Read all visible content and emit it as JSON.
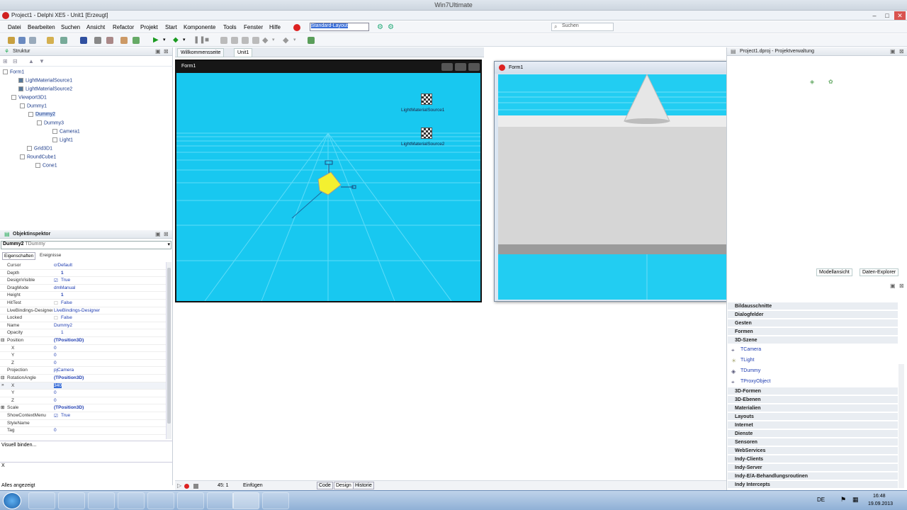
{
  "os_title": "Win7Ultimate",
  "ide_title": "Project1 - Delphi XE5 - Unit1 [Erzeugt]",
  "menu": [
    "Datei",
    "Bearbeiten",
    "Suchen",
    "Ansicht",
    "Refactor",
    "Projekt",
    "Start",
    "Komponente",
    "Tools",
    "Fenster",
    "Hilfe"
  ],
  "layout_select": "Standard-Layout",
  "search_placeholder": "Suchen",
  "structure": {
    "title": "Struktur",
    "nodes": [
      "Form1",
      "LightMaterialSource1",
      "LightMaterialSource2",
      "Viewport3D1",
      "Dummy1",
      "Dummy2",
      "Dummy3",
      "Camera1",
      "Light1",
      "Grid3D1",
      "RoundCube1",
      "Cone1"
    ]
  },
  "object_inspector": {
    "title": "Objektinspektor",
    "selected_name": "Dummy2",
    "selected_type": "TDummy",
    "tabs": [
      "Eigenschaften",
      "Ereignisse"
    ],
    "rows": [
      {
        "name": "Cursor",
        "value": "crDefault"
      },
      {
        "name": "Depth",
        "value": "1"
      },
      {
        "name": "DesignVisible",
        "value": "True"
      },
      {
        "name": "DragMode",
        "value": "dmManual"
      },
      {
        "name": "Height",
        "value": "1"
      },
      {
        "name": "HitTest",
        "value": "False"
      },
      {
        "name": "LiveBindings-Designer",
        "value": "LiveBindings-Designer"
      },
      {
        "name": "Locked",
        "value": "False"
      },
      {
        "name": "Name",
        "value": "Dummy2"
      },
      {
        "name": "Opacity",
        "value": "1"
      },
      {
        "name": "Position",
        "value": "(TPosition3D)"
      },
      {
        "name": "X",
        "value": "0"
      },
      {
        "name": "Y",
        "value": "0"
      },
      {
        "name": "Z",
        "value": "0"
      },
      {
        "name": "Projection",
        "value": "pjCamera"
      },
      {
        "name": "RotationAngle",
        "value": "(TPosition3D)"
      },
      {
        "name": "X",
        "value": "340"
      },
      {
        "name": "Y",
        "value": "0"
      },
      {
        "name": "Z",
        "value": "0"
      },
      {
        "name": "Scale",
        "value": "(TPosition3D)"
      },
      {
        "name": "ShowContextMenu",
        "value": "True"
      },
      {
        "name": "StyleName",
        "value": ""
      },
      {
        "name": "Tag",
        "value": "0"
      }
    ],
    "footer_link": "Visuell binden...",
    "footer_x": "X",
    "status": "Alles angezeigt"
  },
  "designer": {
    "tabs": [
      "Willkommensseite",
      "Unit1"
    ],
    "form_caption": "Form1",
    "label1": "LightMaterialSource1",
    "label2": "LightMaterialSource2",
    "bottom_tabs": [
      "Code",
      "Design",
      "Historie"
    ],
    "cursor_pos": "45:   1",
    "mode": "Einfügen"
  },
  "preview_title": "Form1",
  "project_manager": {
    "title": "Project1.dproj - Projektverwaltung",
    "tabs": [
      "Modellansicht",
      "Daten-Explorer"
    ]
  },
  "palette": {
    "groups": [
      "Bildausschnitte",
      "Dialogfelder",
      "Gesten",
      "Formen",
      "3D-Szene"
    ],
    "items": [
      "TCamera",
      "TLight",
      "TDummy",
      "TProxyObject"
    ],
    "groups_after": [
      "3D-Formen",
      "3D-Ebenen",
      "Materialien",
      "Layouts",
      "Internet",
      "Dienste",
      "Sensoren",
      "WebServices",
      "Indy-Clients",
      "Indy-Server",
      "Indy-E/A-Behandlungsroutinen",
      "Indy Intercepts"
    ]
  },
  "tray": {
    "lang": "DE",
    "time": "16:48",
    "date": "19.09.2013"
  }
}
